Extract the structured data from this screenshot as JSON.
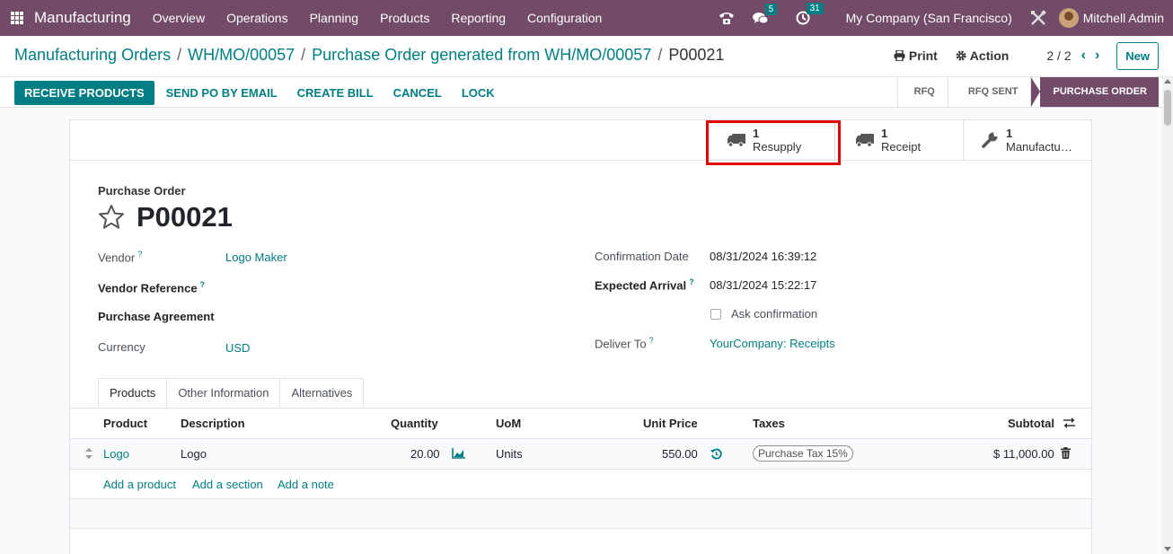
{
  "navbar": {
    "app_name": "Manufacturing",
    "menu": [
      "Overview",
      "Operations",
      "Planning",
      "Products",
      "Reporting",
      "Configuration"
    ],
    "messages_count": "5",
    "activities_count": "31",
    "company": "My Company (San Francisco)",
    "user": "Mitchell Admin"
  },
  "breadcrumb": {
    "items": [
      "Manufacturing Orders",
      "WH/MO/00057",
      "Purchase Order generated from WH/MO/00057"
    ],
    "current": "P00021",
    "separator": "/"
  },
  "control": {
    "print_label": "Print",
    "action_label": "Action",
    "pager": "2 / 2",
    "new_label": "New"
  },
  "statusbar": {
    "buttons": [
      "RECEIVE PRODUCTS",
      "SEND PO BY EMAIL",
      "CREATE BILL",
      "CANCEL",
      "LOCK"
    ],
    "stages": [
      "RFQ",
      "RFQ SENT",
      "PURCHASE ORDER"
    ],
    "active_stage": "PURCHASE ORDER"
  },
  "smart_buttons": [
    {
      "count": "1",
      "label": "Resupply",
      "icon": "truck-icon"
    },
    {
      "count": "1",
      "label": "Receipt",
      "icon": "truck-icon"
    },
    {
      "count": "1",
      "label": "Manufactu…",
      "icon": "wrench-icon"
    }
  ],
  "form": {
    "doc_type": "Purchase Order",
    "name": "P00021",
    "vendor_label": "Vendor",
    "vendor": "Logo Maker",
    "vendor_ref_label": "Vendor Reference",
    "agreement_label": "Purchase Agreement",
    "currency_label": "Currency",
    "currency": "USD",
    "confirmation_label": "Confirmation Date",
    "confirmation_date": "08/31/2024 16:39:12",
    "expected_label": "Expected Arrival",
    "expected_date": "08/31/2024 15:22:17",
    "ask_confirmation": "Ask confirmation",
    "deliver_label": "Deliver To",
    "deliver_to": "YourCompany: Receipts",
    "help_mark": "?"
  },
  "tabs": [
    "Products",
    "Other Information",
    "Alternatives"
  ],
  "table": {
    "columns": [
      "Product",
      "Description",
      "Quantity",
      "UoM",
      "Unit Price",
      "Taxes",
      "Subtotal"
    ],
    "rows": [
      {
        "product": "Logo",
        "description": "Logo",
        "quantity": "20.00",
        "uom": "Units",
        "unit_price": "550.00",
        "taxes": "Purchase Tax 15%",
        "subtotal": "$ 11,000.00"
      }
    ],
    "add_links": [
      "Add a product",
      "Add a section",
      "Add a note"
    ]
  },
  "colors": {
    "brand": "#714b67",
    "accent": "#017e84",
    "highlight": "#e00000"
  }
}
